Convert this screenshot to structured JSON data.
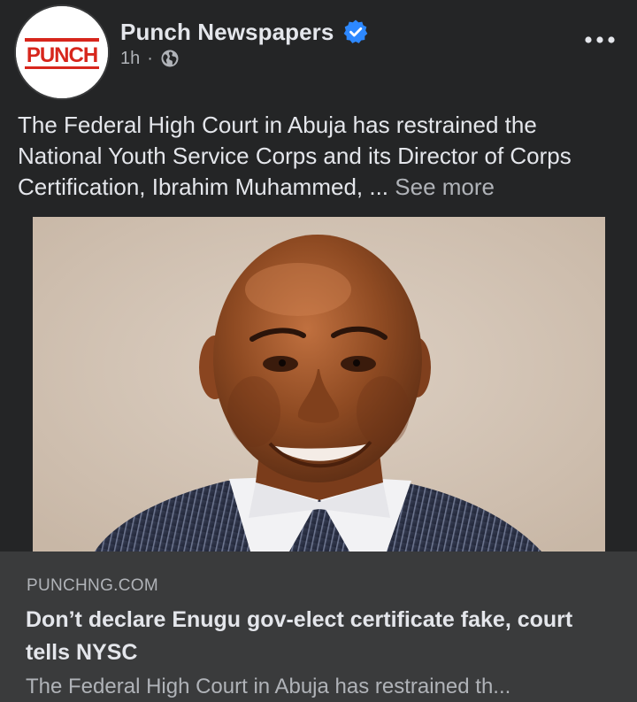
{
  "colors": {
    "background": "#242526",
    "preview_background": "#3a3b3c",
    "primary_text": "#e4e6eb",
    "secondary_text": "#b0b3b8",
    "verified_blue": "#2d88ff",
    "punch_red": "#d7261c"
  },
  "header": {
    "avatar_logo_text": "PUNCH",
    "page_name": "Punch Newspapers",
    "verified_icon": "verified-badge-icon",
    "time": "1h",
    "separator": "·",
    "privacy_icon": "globe-icon",
    "more_icon": "more-horizontal-icon"
  },
  "post": {
    "text": "The Federal High Court in Abuja has restrained the National Youth Service Corps and its Director of Corps Certification, Ibrahim Muhammed, ... ",
    "see_more": "See more"
  },
  "image": {
    "subject": "portrait-photo"
  },
  "link_preview": {
    "domain": "PUNCHNG.COM",
    "title": "Don’t declare Enugu gov-elect certificate fake, court tells NYSC",
    "description": "The Federal High Court in Abuja has restrained th..."
  }
}
